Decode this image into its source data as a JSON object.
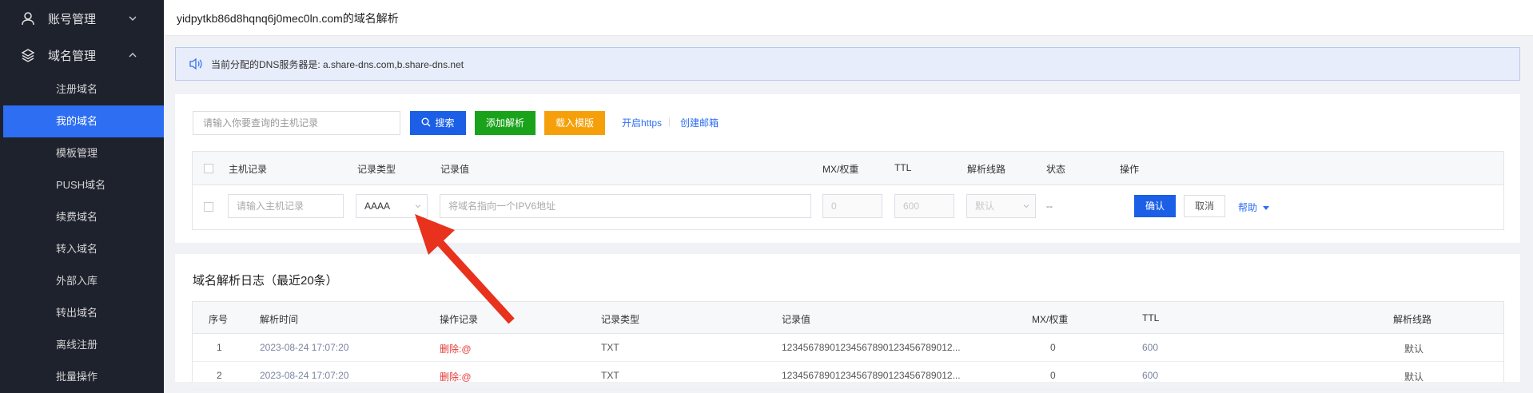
{
  "sidebar": {
    "account": {
      "label": "账号管理",
      "icon": "user-icon"
    },
    "domain": {
      "label": "域名管理",
      "icon": "layers-icon"
    },
    "items": [
      {
        "label": "注册域名"
      },
      {
        "label": "我的域名",
        "active": true
      },
      {
        "label": "模板管理"
      },
      {
        "label": "PUSH域名"
      },
      {
        "label": "续费域名"
      },
      {
        "label": "转入域名"
      },
      {
        "label": "外部入库"
      },
      {
        "label": "转出域名"
      },
      {
        "label": "离线注册"
      },
      {
        "label": "批量操作"
      }
    ]
  },
  "header": {
    "title": "yidpytkb86d8hqnq6j0mec0ln.com的域名解析"
  },
  "notice": {
    "text": "当前分配的DNS服务器是: a.share-dns.com,b.share-dns.net"
  },
  "toolbar": {
    "search_placeholder": "请输入你要查询的主机记录",
    "search_label": "搜索",
    "add_label": "添加解析",
    "template_label": "载入模版",
    "https_link": "开启https",
    "mail_link": "创建邮箱"
  },
  "record_table": {
    "headers": [
      "主机记录",
      "记录类型",
      "记录值",
      "MX/权重",
      "TTL",
      "解析线路",
      "状态",
      "操作"
    ],
    "edit_row": {
      "host_placeholder": "请输入主机记录",
      "type_value": "AAAA",
      "value_placeholder": "将域名指向一个IPV6地址",
      "mx_value": "0",
      "ttl_value": "600",
      "line_value": "默认",
      "status": "--",
      "confirm_label": "确认",
      "cancel_label": "取消",
      "help_label": "帮助"
    }
  },
  "log": {
    "title": "域名解析日志（最近20条）",
    "headers": [
      "序号",
      "解析时间",
      "操作记录",
      "记录类型",
      "记录值",
      "MX/权重",
      "TTL",
      "解析线路"
    ],
    "rows": [
      {
        "no": "1",
        "time": "2023-08-24 17:07:20",
        "action": "删除:@",
        "type": "TXT",
        "value": "12345678901234567890123456789012...",
        "mx": "0",
        "ttl": "600",
        "line": "默认"
      },
      {
        "no": "2",
        "time": "2023-08-24 17:07:20",
        "action": "删除:@",
        "type": "TXT",
        "value": "12345678901234567890123456789012...",
        "mx": "0",
        "ttl": "600",
        "line": "默认"
      }
    ]
  },
  "colors": {
    "sidebar_bg": "#1e222d",
    "active_item": "#2d6ef2",
    "search_btn": "#1a5fe6",
    "add_btn": "#1aa31a",
    "template_btn": "#f5a00a",
    "annotation_arrow": "#e8321e"
  }
}
